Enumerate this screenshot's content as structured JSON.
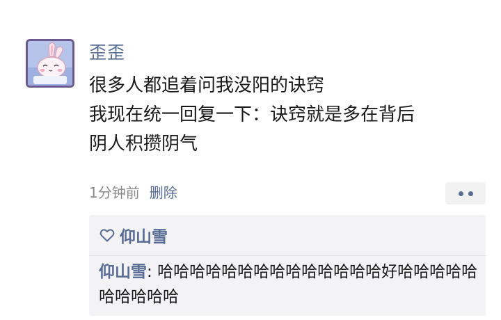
{
  "post": {
    "author": "歪歪",
    "text_lines": [
      "很多人都追着问我没阳的诀窍",
      "我现在统一回复一下：诀窍就是多在背后",
      "阴人积攒阴气"
    ],
    "time": "1分钟前",
    "delete_label": "删除"
  },
  "likes": {
    "names": "仰山雪"
  },
  "comments": [
    {
      "author": "仰山雪",
      "separator": ": ",
      "text": "哈哈哈哈哈哈哈哈哈哈哈哈哈哈好哈哈哈哈哈哈哈哈哈哈"
    }
  ],
  "icons": {
    "avatar": "bunny-avatar",
    "more": "more-dots-icon",
    "like": "heart-outline-icon"
  },
  "colors": {
    "link": "#576b95",
    "text": "#1a1a1a",
    "meta": "#8a8a8a",
    "panel_bg": "#f3f3f5"
  }
}
